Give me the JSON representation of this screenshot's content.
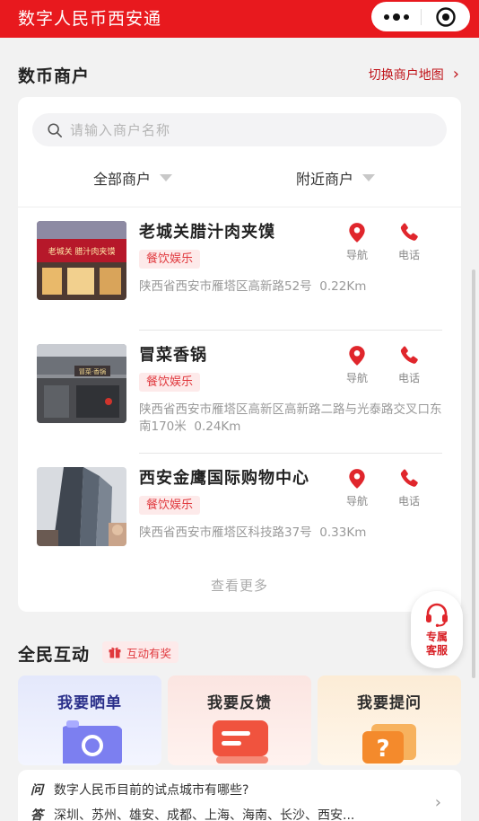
{
  "app": {
    "title": "数字人民币西安通"
  },
  "merchants_section": {
    "title": "数币商户",
    "map_link": "切换商户地图",
    "search_placeholder": "请输入商户名称",
    "filter_all": "全部商户",
    "filter_nearby": "附近商户",
    "items": [
      {
        "name": "老城关腊汁肉夹馍",
        "tag": "餐饮娱乐",
        "address": "陕西省西安市雁塔区高新路52号",
        "distance": "0.22Km"
      },
      {
        "name": "冒菜香锅",
        "tag": "餐饮娱乐",
        "address": "陕西省西安市雁塔区高新区高新路二路与光泰路交叉口东南170米",
        "distance": "0.24Km"
      },
      {
        "name": "西安金鹰国际购物中心",
        "tag": "餐饮娱乐",
        "address": "陕西省西安市雁塔区科技路37号",
        "distance": "0.33Km"
      }
    ],
    "nav_label": "导航",
    "phone_label": "电话",
    "see_more": "查看更多",
    "sign_texts": {
      "shop1": "老城关 腊汁肉夹馍",
      "shop2": "冒菜·香锅"
    }
  },
  "service": {
    "line1": "专属",
    "line2": "客服"
  },
  "interaction_section": {
    "title": "全民互动",
    "badge": "互动有奖",
    "tiles": [
      {
        "label": "我要晒单"
      },
      {
        "label": "我要反馈"
      },
      {
        "label": "我要提问"
      }
    ]
  },
  "faq": {
    "q_mark": "问",
    "question": "数字人民币目前的试点城市有哪些?",
    "a_mark": "答",
    "answer": "深圳、苏州、雄安、成都、上海、海南、长沙、西安..."
  },
  "colors": {
    "brand_red": "#e8191e",
    "tag_red": "#e0383d"
  }
}
